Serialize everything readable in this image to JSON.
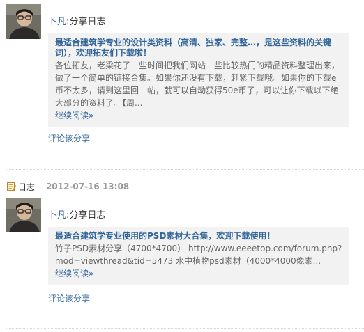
{
  "feed": {
    "entries": [
      {
        "author": "卜凡",
        "separator": ":",
        "action": "分享日志",
        "card": {
          "title": "最适合建筑学专业的设计类资料（高清、独家、完整…，是这些资料的关键词），欢迎拓友们下载啦！",
          "summary": "各位拓友，老梁花了一些时间把我们网站一些比较热门的精品资料整理出来，做了一个简单的链接合集。如果你还没有下载，赶紧下载哦。如果你的下载e币不太多，请到这里回一帖，就可以自动获得50e币了，可以让你下载以下绝大部分的资料了。【周...",
          "more": "继续阅读»"
        },
        "comment": "评论该分享"
      },
      {
        "type_label": "日志",
        "date": "2012-07-16 13:08",
        "author": "卜凡",
        "separator": ":",
        "action": "分享日志",
        "card": {
          "title": "最适合建筑学专业使用的PSD素材大合集，欢迎下载使用！",
          "summary": "竹子PSD素材分享（4700*4700） http://www.eeeetop.com/forum.php?mod=viewthread&tid=5473 水中植物psd素材（4000*4000像素...",
          "more": "继续阅读»"
        },
        "comment": "评论该分享"
      }
    ]
  },
  "colors": {
    "link": "#336699",
    "card_bg": "#f2f2f2",
    "summary_text": "#666666",
    "date_text": "#999999"
  },
  "icons": {
    "avatar": "user-avatar",
    "blog": "blog-notebook-icon"
  }
}
